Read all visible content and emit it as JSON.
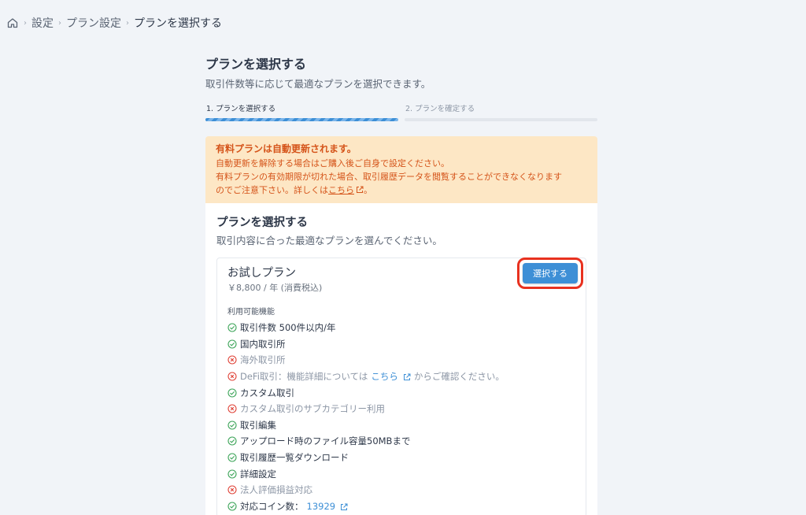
{
  "breadcrumb": {
    "items": [
      "設定",
      "プラン設定"
    ],
    "current": "プランを選択する"
  },
  "page": {
    "title": "プランを選択する",
    "subtitle": "取引件数等に応じて最適なプランを選択できます。"
  },
  "steps": [
    {
      "label": "1. プランを選択する",
      "state": "active"
    },
    {
      "label": "2. プランを確定する",
      "state": "inactive"
    }
  ],
  "warning": {
    "title": "有料プランは自動更新されます。",
    "line1": "自動更新を解除する場合はご購入後ご自身で設定ください。",
    "line2_prefix": "有料プランの有効期限が切れた場合、取引履歴データを閲覧することができなくなります",
    "line3_prefix": "のでご注意下さい。詳しくは",
    "link": "こちら",
    "line3_suffix": "。",
    "color": "#d5541a",
    "background": "#fde7c5"
  },
  "card": {
    "title": "プランを選択する",
    "subtitle": "取引内容に合った最適なプランを選んでください。"
  },
  "plan": {
    "name": "お試しプラン",
    "price": "￥8,800 / 年 (消費税込)",
    "select_label": "選択する",
    "features_label": "利用可能機能",
    "features": [
      {
        "text": "取引件数 500件以内/年",
        "available": true
      },
      {
        "text": "国内取引所",
        "available": true
      },
      {
        "text": "海外取引所",
        "available": false
      },
      {
        "text": "DeFi取引：機能詳細については",
        "link": "こちら",
        "suffix": "からご確認ください。",
        "available": false
      },
      {
        "text": "カスタム取引",
        "available": true
      },
      {
        "text": "カスタム取引のサブカテゴリー利用",
        "available": false
      },
      {
        "text": "取引編集",
        "available": true
      },
      {
        "text": "アップロード時のファイル容量50MBまで",
        "available": true
      },
      {
        "text": "取引履歴一覧ダウンロード",
        "available": true
      },
      {
        "text": "詳細設定",
        "available": true
      },
      {
        "text": "法人評価損益対応",
        "available": false
      },
      {
        "text": "対応コイン数：",
        "link": "13929",
        "available": true
      }
    ]
  },
  "colors": {
    "accent": "#3d8fd6",
    "check": "#3ea55a",
    "cross": "#e0453a",
    "highlight": "#e8311f"
  }
}
